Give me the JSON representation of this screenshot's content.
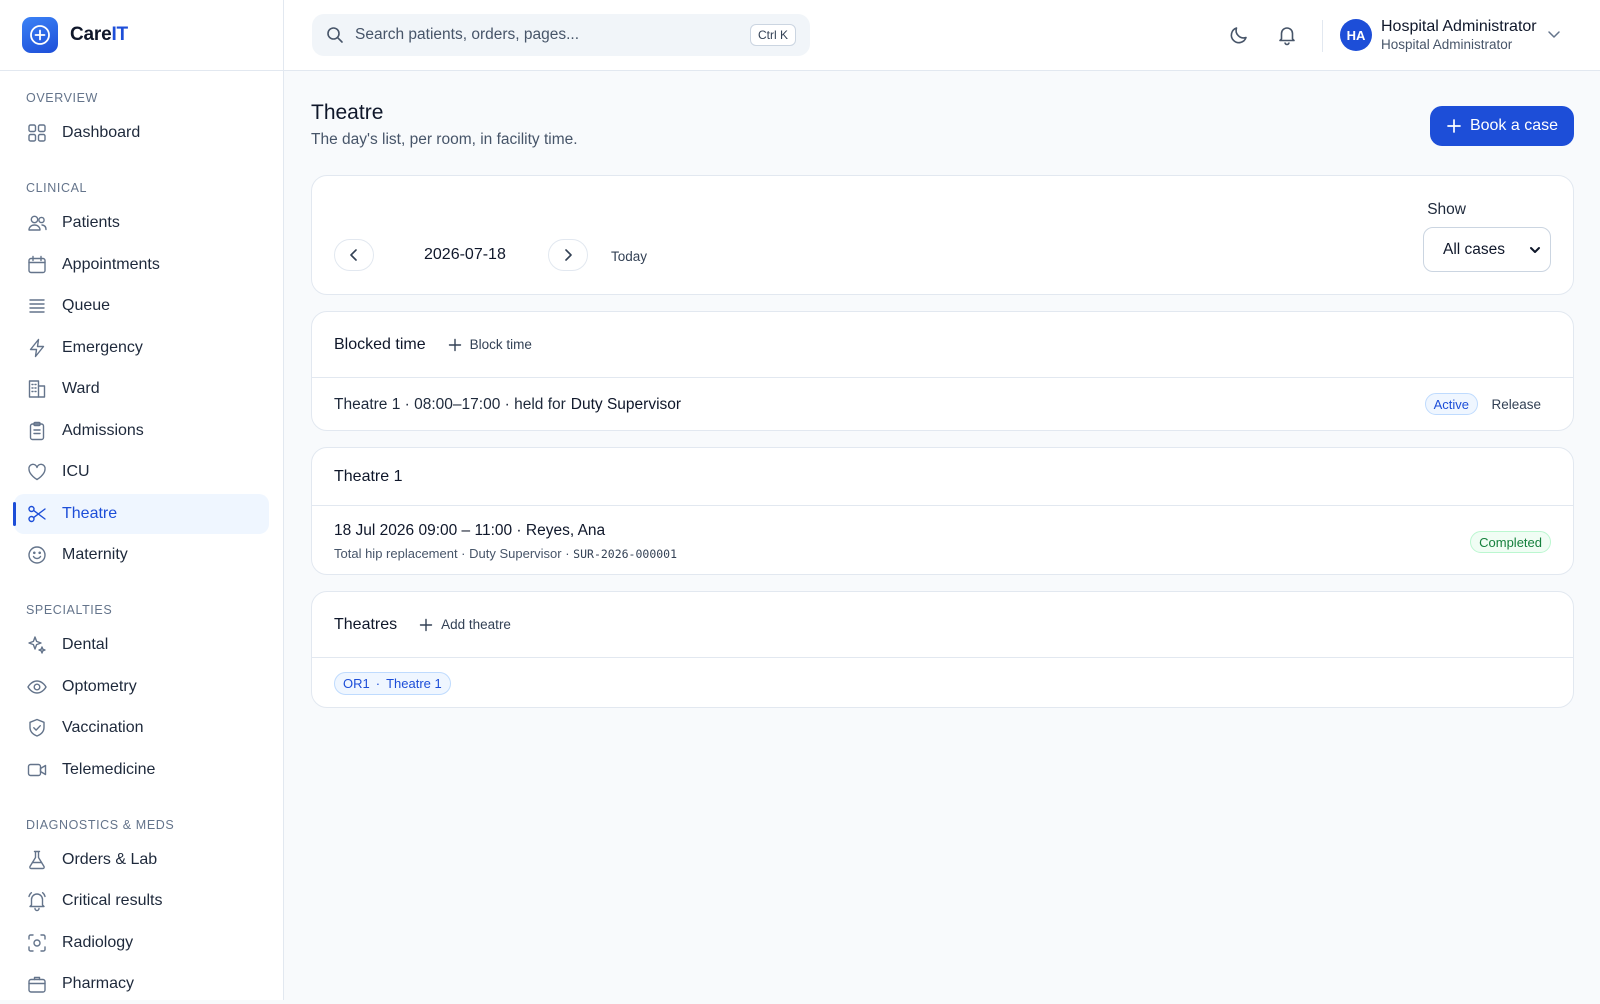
{
  "brand": {
    "name_part1": "Care",
    "name_part2": "IT"
  },
  "search": {
    "placeholder": "Search patients, orders, pages...",
    "shortcut": "Ctrl K"
  },
  "user": {
    "initials": "HA",
    "name": "Hospital Administrator",
    "role": "Hospital Administrator"
  },
  "sidebar": {
    "sections": [
      {
        "title": "OVERVIEW",
        "items": [
          {
            "label": "Dashboard",
            "icon": "grid-icon"
          }
        ]
      },
      {
        "title": "CLINICAL",
        "items": [
          {
            "label": "Patients",
            "icon": "users-icon"
          },
          {
            "label": "Appointments",
            "icon": "calendar-icon"
          },
          {
            "label": "Queue",
            "icon": "list-icon"
          },
          {
            "label": "Emergency",
            "icon": "zap-icon"
          },
          {
            "label": "Ward",
            "icon": "building-icon"
          },
          {
            "label": "Admissions",
            "icon": "clipboard-icon"
          },
          {
            "label": "ICU",
            "icon": "heart-icon"
          },
          {
            "label": "Theatre",
            "icon": "scissors-icon",
            "active": true
          },
          {
            "label": "Maternity",
            "icon": "smile-icon"
          }
        ]
      },
      {
        "title": "SPECIALTIES",
        "items": [
          {
            "label": "Dental",
            "icon": "sparkle-icon"
          },
          {
            "label": "Optometry",
            "icon": "eye-icon"
          },
          {
            "label": "Vaccination",
            "icon": "shield-check-icon"
          },
          {
            "label": "Telemedicine",
            "icon": "video-icon"
          }
        ]
      },
      {
        "title": "DIAGNOSTICS & MEDS",
        "items": [
          {
            "label": "Orders & Lab",
            "icon": "flask-icon"
          },
          {
            "label": "Critical results",
            "icon": "bell-alert-icon"
          },
          {
            "label": "Radiology",
            "icon": "scan-icon"
          },
          {
            "label": "Pharmacy",
            "icon": "box-icon"
          }
        ]
      }
    ]
  },
  "page": {
    "title": "Theatre",
    "subtitle": "The day's list, per room, in facility time.",
    "book_label": "Book a case"
  },
  "date_nav": {
    "date": "2026-07-18",
    "today_label": "Today",
    "show_label": "Show",
    "show_value": "All cases"
  },
  "blocked": {
    "title": "Blocked time",
    "add_label": "Block time",
    "row_text": "Theatre 1 · 08:00–17:00 · held for",
    "row_holder": "Duty Supervisor",
    "status": "Active",
    "release_label": "Release"
  },
  "theatre1": {
    "title": "Theatre 1",
    "case_title": "18 Jul 2026 09:00 – 11:00 · Reyes, Ana",
    "case_meta": "Total hip replacement · Duty Supervisor ·",
    "case_ref": "SUR-2026-000001",
    "status": "Completed"
  },
  "theatres": {
    "title": "Theatres",
    "add_label": "Add theatre",
    "chip_code": "OR1",
    "chip_sep": "·",
    "chip_name": "Theatre 1"
  },
  "colors": {
    "accent": "#1d4ed8",
    "success": "#15803d",
    "border": "#e2e8f0"
  }
}
